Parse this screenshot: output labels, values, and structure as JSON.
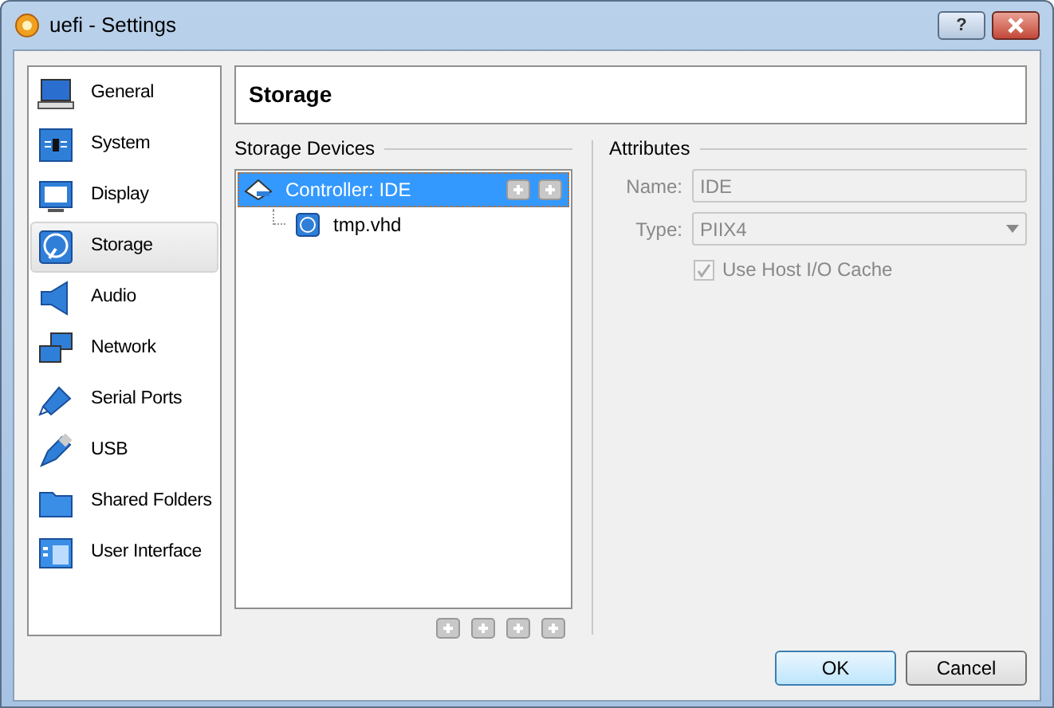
{
  "window": {
    "title": "uefi - Settings",
    "buttons": [
      "?"
    ]
  },
  "sidebar": {
    "items": [
      {
        "label": "General",
        "selected": false
      },
      {
        "label": "System",
        "selected": false
      },
      {
        "label": "Display",
        "selected": false
      },
      {
        "label": "Storage",
        "selected": true
      },
      {
        "label": "Audio",
        "selected": false
      },
      {
        "label": "Network",
        "selected": false
      },
      {
        "label": "Serial Ports",
        "selected": false
      },
      {
        "label": "USB",
        "selected": false
      },
      {
        "label": "Shared Folders",
        "selected": false
      },
      {
        "label": "User Interface",
        "selected": false
      }
    ]
  },
  "page_title": "Storage",
  "storage_devices": {
    "title": "Storage Devices",
    "tree": [
      {
        "label": "Controller: IDE",
        "selected": true,
        "children": [
          {
            "label": "tmp.vhd",
            "selected": false
          }
        ]
      }
    ]
  },
  "attributes": {
    "title": "Attributes",
    "name": {
      "label": "Name:",
      "value": "IDE",
      "disabled": true
    },
    "type": {
      "label": "Type:",
      "value": "PIIX4",
      "disabled": true
    },
    "host_cache": {
      "label": "Use Host I/O Cache",
      "checked": true,
      "disabled": true
    }
  },
  "buttons": [
    {
      "label": "OK",
      "default": true
    },
    {
      "label": "Cancel",
      "default": false
    }
  ]
}
